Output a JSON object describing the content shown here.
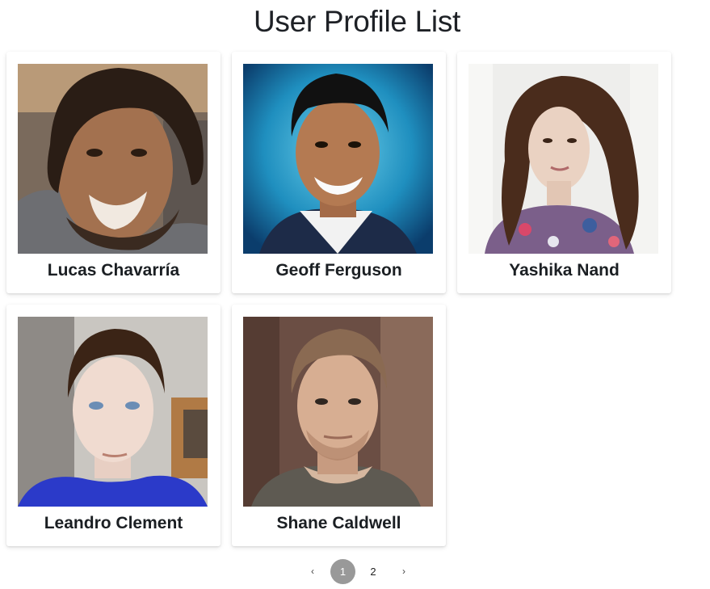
{
  "page": {
    "title": "User Profile List"
  },
  "users": [
    {
      "name": "Lucas Chavarría"
    },
    {
      "name": "Geoff Ferguson"
    },
    {
      "name": "Yashika Nand"
    },
    {
      "name": "Leandro Clement"
    },
    {
      "name": "Shane Caldwell"
    }
  ],
  "pagination": {
    "prev_icon": "chevron-left-icon",
    "next_icon": "chevron-right-icon",
    "prev_glyph": "‹",
    "next_glyph": "›",
    "pages": [
      "1",
      "2"
    ],
    "current_page": "1",
    "active_color": "#999999"
  }
}
